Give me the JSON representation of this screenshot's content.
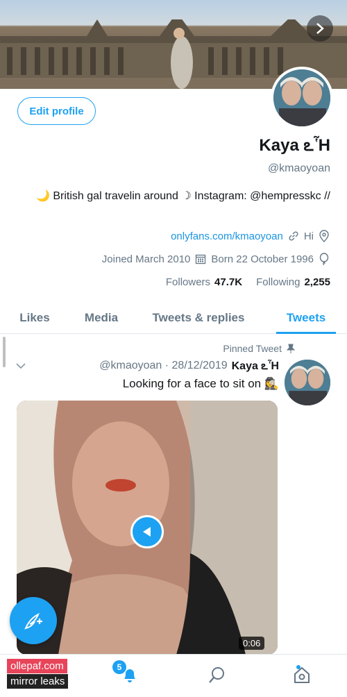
{
  "profile": {
    "name": "Kaya ఽἯ",
    "handle": "@kmaoyoan",
    "edit_label": "Edit profile",
    "bio": "🌙 British gal travelin around ☽ Instagram: @hempresskc //",
    "location": "Hi",
    "website": "onlyfans.com/kmaoyoan",
    "born": "Born 22 October 1996",
    "joined": "Joined March 2010",
    "following_count": "2,255",
    "following_label": "Following",
    "followers_count": "47.7K",
    "followers_label": "Followers"
  },
  "tabs": [
    {
      "label": "Tweets",
      "active": true
    },
    {
      "label": "Tweets & replies",
      "active": false
    },
    {
      "label": "Media",
      "active": false
    },
    {
      "label": "Likes",
      "active": false
    }
  ],
  "tweet": {
    "pinned_label": "Pinned Tweet",
    "author": "Kaya ఽἯ",
    "meta": "@kmaoyoan · 28/12/2019",
    "text": "Looking for a face to sit on 🕵️‍♀️",
    "duration": "0:06"
  },
  "nav": {
    "notifications_badge": "5"
  },
  "watermark": {
    "line1": "ollepaf.com",
    "line2": "mirror leaks"
  },
  "colors": {
    "accent": "#1da1f2",
    "secondary_text": "#657786"
  }
}
